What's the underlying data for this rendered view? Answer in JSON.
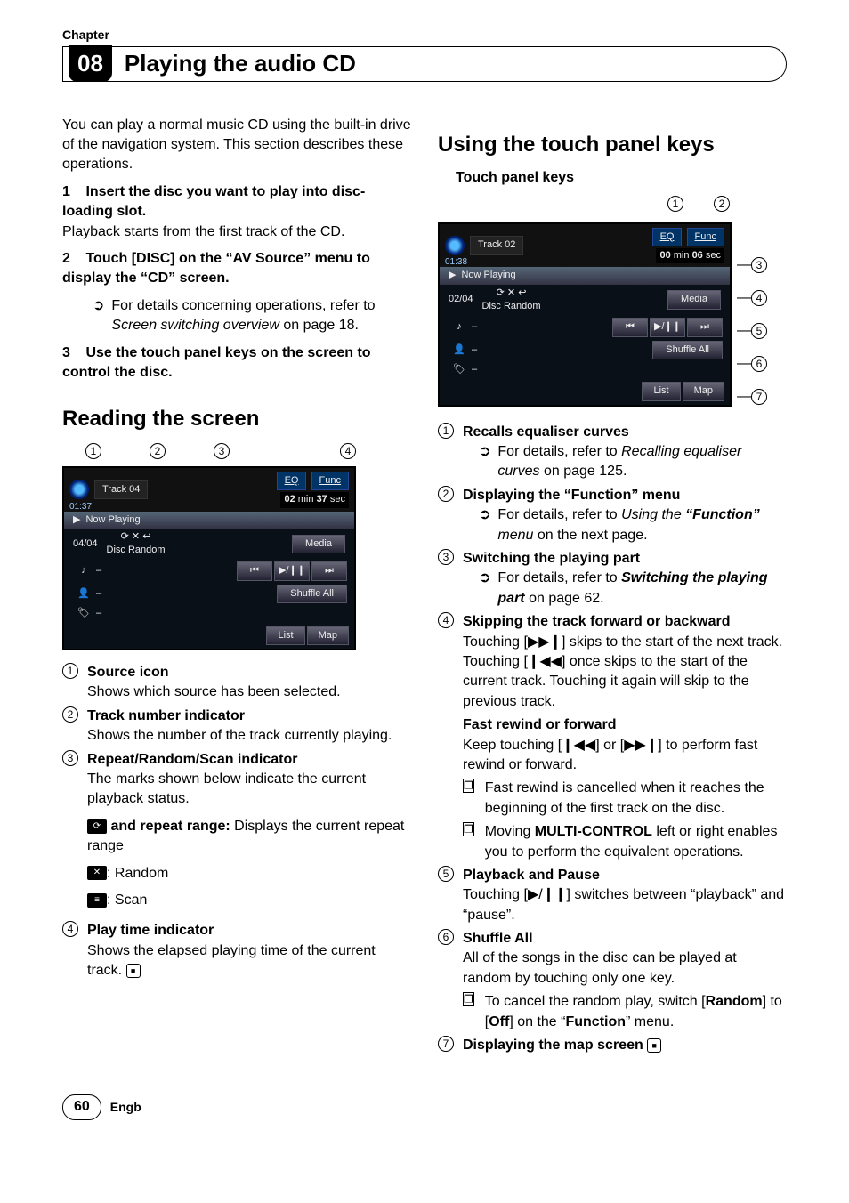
{
  "chapter": {
    "label": "Chapter",
    "number": "08",
    "title": "Playing the audio CD"
  },
  "intro": "You can play a normal music CD using the built-in drive of the navigation system. This section describes these operations.",
  "steps": [
    {
      "num": "1",
      "title": "Insert the disc you want to play into disc-loading slot.",
      "body": "Playback starts from the first track of the CD."
    },
    {
      "num": "2",
      "title": "Touch [DISC] on the “AV Source” menu to display the “CD” screen.",
      "sub_prefix": "For details concerning operations, refer to ",
      "sub_italic": "Screen switching overview",
      "sub_suffix": " on page 18."
    },
    {
      "num": "3",
      "title": "Use the touch panel keys on the screen to control the disc."
    }
  ],
  "reading": {
    "heading": "Reading the screen",
    "annot": {
      "t1": "1",
      "t2": "2",
      "t3": "3",
      "t4": "4"
    },
    "shot": {
      "track": "Track 04",
      "clock": "01:37",
      "eq": "EQ",
      "func": "Func",
      "time_min": "02",
      "time_min_lbl": "min",
      "time_sec": "37",
      "time_sec_lbl": "sec",
      "now": "Now Playing",
      "counter": "04/04",
      "mode": "Disc Random",
      "media": "Media",
      "dash": "–",
      "prev": "⏮",
      "play": "▶/❙❙",
      "next": "⏭",
      "shuffle": "Shuffle All",
      "list": "List",
      "map": "Map"
    },
    "callouts": [
      {
        "n": "1",
        "title": "Source icon",
        "body": "Shows which source has been selected."
      },
      {
        "n": "2",
        "title": "Track number indicator",
        "body": "Shows the number of the track currently playing."
      },
      {
        "n": "3",
        "title": "Repeat/Random/Scan indicator",
        "body": "The marks shown below indicate the current playback status."
      },
      {
        "n": "4",
        "title": "Play time indicator",
        "body": "Shows the elapsed playing time of the current track."
      }
    ],
    "marks": {
      "repeat_label": " and repeat range:",
      "repeat_body": " Displays the current repeat range",
      "random": ": Random",
      "scan": ": Scan"
    }
  },
  "using": {
    "heading": "Using the touch panel keys",
    "subheading": "Touch panel keys",
    "shot": {
      "track": "Track 02",
      "clock": "01:38",
      "eq": "EQ",
      "func": "Func",
      "time_min": "00",
      "time_min_lbl": "min",
      "time_sec": "06",
      "time_sec_lbl": "sec",
      "now": "Now Playing",
      "counter": "02/04",
      "mode": "Disc Random",
      "media": "Media",
      "dash": "–",
      "prev": "⏮",
      "play": "▶/❙❙",
      "next": "⏭",
      "shuffle": "Shuffle All",
      "list": "List",
      "map": "Map"
    },
    "annot": {
      "t1": "1",
      "t2": "2",
      "s3": "3",
      "s4": "4",
      "s5": "5",
      "s6": "6",
      "s7": "7"
    },
    "callouts": {
      "c1": {
        "n": "1",
        "title": "Recalls equaliser curves",
        "ref_pre": "For details, refer to ",
        "ref_it": "Recalling equaliser curves",
        "ref_post": " on page 125."
      },
      "c2": {
        "n": "2",
        "title": "Displaying the “Function” menu",
        "ref_pre": "For details, refer to ",
        "ref_it": "Using the ",
        "ref_bold": "“Function”",
        "ref_it2": " menu",
        "ref_post": " on the next page."
      },
      "c3": {
        "n": "3",
        "title": "Switching the playing part",
        "ref_pre": "For details, refer to ",
        "ref_bi": "Switching the playing part",
        "ref_post": " on page 62."
      },
      "c4": {
        "n": "4",
        "title": "Skipping the track forward or backward",
        "body1_a": "Touching [",
        "body1_b": "] skips to the start of the next track. Touching [",
        "body1_c": "] once skips to the start of the current track. Touching it again will skip to the previous track.",
        "fast_title": "Fast rewind or forward",
        "fast_body_a": "Keep touching [",
        "fast_body_b": "] or [",
        "fast_body_c": "] to perform fast rewind or forward.",
        "note1": "Fast rewind is cancelled when it reaches the beginning of the first track on the disc.",
        "note2_a": "Moving ",
        "note2_b": "MULTI-CONTROL",
        "note2_c": " left or right enables you to perform the equivalent operations."
      },
      "c5": {
        "n": "5",
        "title": "Playback and Pause",
        "body_a": "Touching [",
        "body_b": "] switches between “playback” and “pause”."
      },
      "c6": {
        "n": "6",
        "title": "Shuffle All",
        "body": "All of the songs in the disc can be played at random by touching only one key.",
        "note_a": "To cancel the random play, switch [",
        "note_b": "Random",
        "note_c": "] to [",
        "note_d": "Off",
        "note_e": "] on the “",
        "note_f": "Function",
        "note_g": "” menu."
      },
      "c7": {
        "n": "7",
        "title": "Displaying the map screen"
      }
    },
    "icons": {
      "next": "▶▶❙",
      "prev": "❙◀◀",
      "playpause": "▶/❙❙"
    }
  },
  "footer": {
    "page": "60",
    "lang": "Engb"
  }
}
